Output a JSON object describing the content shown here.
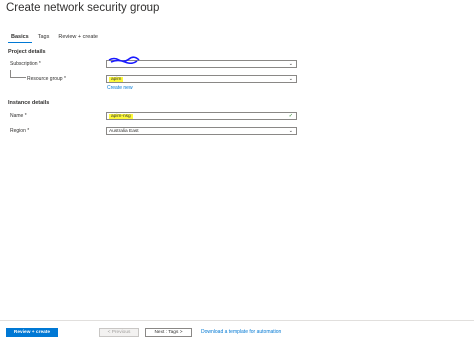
{
  "page": {
    "title": "Create network security group",
    "more": "···"
  },
  "tabs": [
    {
      "label": "Basics"
    },
    {
      "label": "Tags"
    },
    {
      "label": "Review + create"
    }
  ],
  "project": {
    "heading": "Project details",
    "subscription_label": "Subscription *",
    "subscription_value": "",
    "resource_group_label": "Resource group *",
    "resource_group_value": "apim",
    "create_new": "Create new"
  },
  "instance": {
    "heading": "Instance details",
    "name_label": "Name *",
    "name_value": "apim-nsg",
    "region_label": "Region *",
    "region_value": "Australia East"
  },
  "footer": {
    "review_create": "Review + create",
    "previous": "< Previous",
    "next": "Next : Tags >",
    "download": "Download a template for automation"
  },
  "colors": {
    "accent": "#0078d4",
    "highlight": "#fdf93b",
    "scribble": "#1a1aff"
  }
}
